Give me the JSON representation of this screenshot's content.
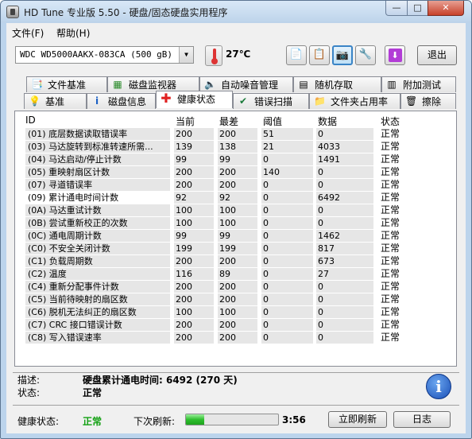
{
  "window": {
    "title": "HD Tune 专业版 5.50 - 硬盘/固态硬盘实用程序",
    "min_glyph": "—",
    "max_glyph": "□",
    "close_glyph": "✕"
  },
  "menu": [
    {
      "label": "文件(F)"
    },
    {
      "label": "帮助(H)"
    }
  ],
  "toolbar": {
    "drive": "WDC WD5000AAKX-083CA (500 gB)",
    "temperature": "27℃",
    "exit_label": "退出"
  },
  "tabs_row1": [
    {
      "label": "文件基准",
      "icon": "file-benchmark-icon"
    },
    {
      "label": "磁盘监视器",
      "icon": "disk-monitor-icon"
    },
    {
      "label": "自动噪音管理",
      "icon": "speaker-icon"
    },
    {
      "label": "随机存取",
      "icon": "random-access-icon"
    },
    {
      "label": "附加测试",
      "icon": "extra-tests-icon"
    }
  ],
  "tabs_row2": [
    {
      "label": "基准",
      "icon": "benchmark-icon"
    },
    {
      "label": "磁盘信息",
      "icon": "info-icon"
    },
    {
      "label": "健康状态",
      "icon": "health-cross-icon"
    },
    {
      "label": "错误扫描",
      "icon": "error-scan-icon"
    },
    {
      "label": "文件夹占用率",
      "icon": "folder-icon"
    },
    {
      "label": "擦除",
      "icon": "trash-icon"
    }
  ],
  "columns": {
    "id": "ID",
    "current": "当前",
    "worst": "最差",
    "threshold": "阈值",
    "data": "数据",
    "status": "状态"
  },
  "rows": [
    {
      "id": "(01) 底层数据读取错误率",
      "current": "200",
      "worst": "200",
      "threshold": "51",
      "data": "0",
      "status": "正常"
    },
    {
      "id": "(03) 马达旋转到标准转速所需...",
      "current": "139",
      "worst": "138",
      "threshold": "21",
      "data": "4033",
      "status": "正常"
    },
    {
      "id": "(04) 马达启动/停止计数",
      "current": "99",
      "worst": "99",
      "threshold": "0",
      "data": "1491",
      "status": "正常"
    },
    {
      "id": "(05) 重映射扇区计数",
      "current": "200",
      "worst": "200",
      "threshold": "140",
      "data": "0",
      "status": "正常"
    },
    {
      "id": "(07) 寻道错误率",
      "current": "200",
      "worst": "200",
      "threshold": "0",
      "data": "0",
      "status": "正常"
    },
    {
      "id": "(09) 累计通电时间计数",
      "current": "92",
      "worst": "92",
      "threshold": "0",
      "data": "6492",
      "status": "正常"
    },
    {
      "id": "(0A) 马达重试计数",
      "current": "100",
      "worst": "100",
      "threshold": "0",
      "data": "0",
      "status": "正常"
    },
    {
      "id": "(0B) 尝试重新校正的次数",
      "current": "100",
      "worst": "100",
      "threshold": "0",
      "data": "0",
      "status": "正常"
    },
    {
      "id": "(0C) 通电周期计数",
      "current": "99",
      "worst": "99",
      "threshold": "0",
      "data": "1462",
      "status": "正常"
    },
    {
      "id": "(C0) 不安全关闭计数",
      "current": "199",
      "worst": "199",
      "threshold": "0",
      "data": "817",
      "status": "正常"
    },
    {
      "id": "(C1) 负载周期数",
      "current": "200",
      "worst": "200",
      "threshold": "0",
      "data": "673",
      "status": "正常"
    },
    {
      "id": "(C2) 温度",
      "current": "116",
      "worst": "89",
      "threshold": "0",
      "data": "27",
      "status": "正常"
    },
    {
      "id": "(C4) 重新分配事件计数",
      "current": "200",
      "worst": "200",
      "threshold": "0",
      "data": "0",
      "status": "正常"
    },
    {
      "id": "(C5) 当前待映射的扇区数",
      "current": "200",
      "worst": "200",
      "threshold": "0",
      "data": "0",
      "status": "正常"
    },
    {
      "id": "(C6) 脱机无法纠正的扇区数",
      "current": "100",
      "worst": "100",
      "threshold": "0",
      "data": "0",
      "status": "正常"
    },
    {
      "id": "(C7) CRC 接口错误计数",
      "current": "200",
      "worst": "200",
      "threshold": "0",
      "data": "0",
      "status": "正常"
    },
    {
      "id": "(C8) 写入错误速率",
      "current": "200",
      "worst": "200",
      "threshold": "0",
      "data": "0",
      "status": "正常"
    }
  ],
  "selected_row": 5,
  "details": {
    "desc_label": "描述:",
    "desc_value": "硬盘累计通电时间: 6492 (270 天)",
    "status_label": "状态:",
    "status_value": "正常",
    "info_glyph": "i"
  },
  "bottom": {
    "health_label": "健康状态:",
    "health_value": "正常",
    "refresh_label": "下次刷新:",
    "progress_fraction": 0.2,
    "countdown": "3:56",
    "refresh_button": "立即刷新",
    "log_button": "日志"
  }
}
